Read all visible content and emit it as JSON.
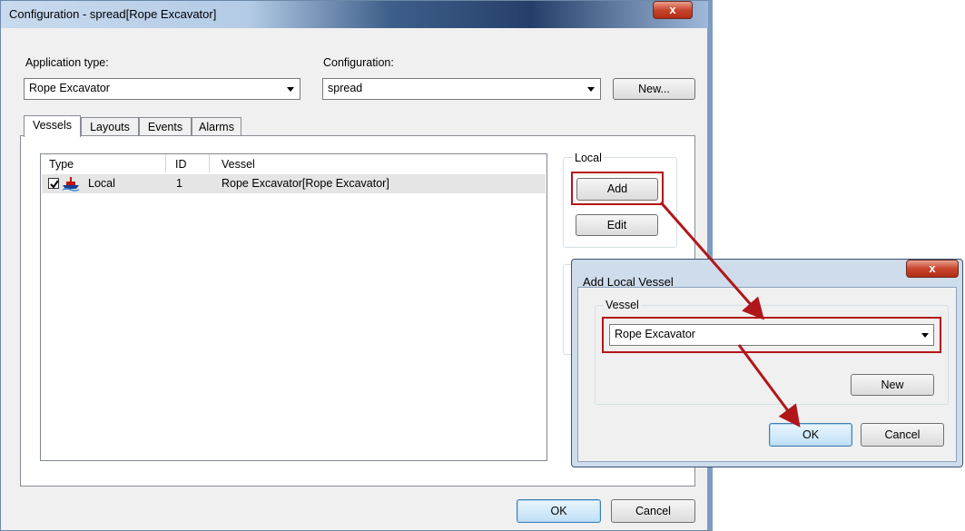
{
  "main_window": {
    "title": "Configuration - spread[Rope Excavator]",
    "close_glyph": "x",
    "application_type_label": "Application type:",
    "application_type_value": "Rope Excavator",
    "configuration_label": "Configuration:",
    "configuration_value": "spread",
    "new_button": "New...",
    "tabs": [
      "Vessels",
      "Layouts",
      "Events",
      "Alarms"
    ],
    "active_tab": "Vessels",
    "table": {
      "columns": [
        "Type",
        "ID",
        "Vessel"
      ],
      "rows": [
        {
          "checked": true,
          "type": "Local",
          "id": "1",
          "vessel": "Rope Excavator[Rope Excavator]"
        }
      ]
    },
    "local_group": {
      "title": "Local",
      "add_button": "Add",
      "edit_button": "Edit"
    },
    "ok_button": "OK",
    "cancel_button": "Cancel"
  },
  "add_local_vessel_dialog": {
    "title": "Add Local Vessel",
    "close_glyph": "x",
    "vessel_group_title": "Vessel",
    "vessel_value": "Rope Excavator",
    "new_button": "New",
    "ok_button": "OK",
    "cancel_button": "Cancel"
  },
  "colors": {
    "highlight_red": "#b51418",
    "arrow_red": "#b0161a",
    "window_face": "#f0f0f0",
    "default_button_border": "#3c7fb1"
  },
  "icons": {
    "vessel_row_icon": "ship-icon",
    "checkbox": "checked-checkbox"
  }
}
